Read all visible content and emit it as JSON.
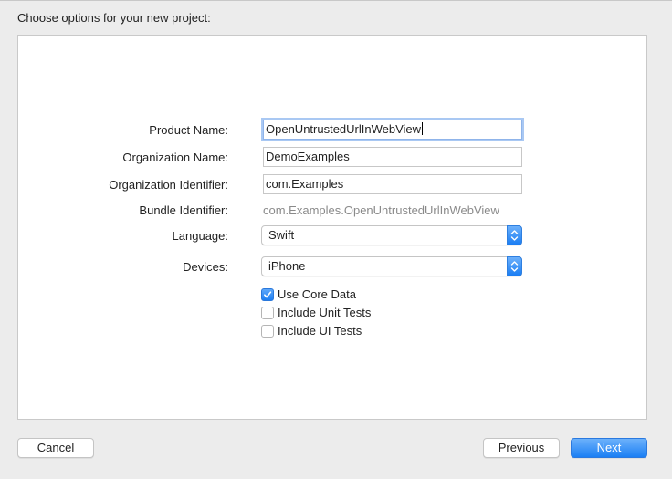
{
  "dialog": {
    "title": "Choose options for your new project:"
  },
  "form": {
    "product_name": {
      "label": "Product Name:",
      "value": "OpenUntrustedUrlInWebView"
    },
    "organization_name": {
      "label": "Organization Name:",
      "value": "DemoExamples"
    },
    "organization_identifier": {
      "label": "Organization Identifier:",
      "value": "com.Examples"
    },
    "bundle_identifier": {
      "label": "Bundle Identifier:",
      "value": "com.Examples.OpenUntrustedUrlInWebView"
    },
    "language": {
      "label": "Language:",
      "value": "Swift"
    },
    "devices": {
      "label": "Devices:",
      "value": "iPhone"
    }
  },
  "options": [
    {
      "label": "Use Core Data",
      "checked": true
    },
    {
      "label": "Include Unit Tests",
      "checked": false
    },
    {
      "label": "Include UI Tests",
      "checked": false
    }
  ],
  "buttons": {
    "cancel": "Cancel",
    "previous": "Previous",
    "next": "Next"
  },
  "icons": {
    "popup_stepper": "up-down-chevron-icon",
    "checkmark": "checkmark-icon"
  },
  "colors": {
    "accent": "#1b7ff4",
    "focus_ring": "#a9c8f3",
    "secondary_text": "#8a8a8a"
  }
}
